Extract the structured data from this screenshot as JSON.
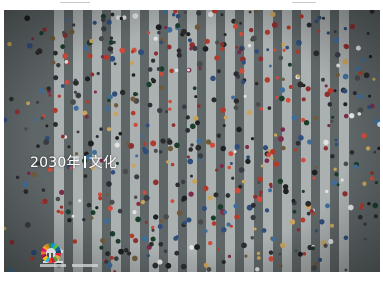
{
  "headline": {
    "year": "2030年",
    "title": "文化"
  },
  "logos": {
    "left": "unesco-logo",
    "right": "sdg-wheel-logo"
  },
  "colors": {
    "crosswalk": "#e9ecec",
    "asphalt": "#5f6668",
    "text": "#ffffff"
  }
}
